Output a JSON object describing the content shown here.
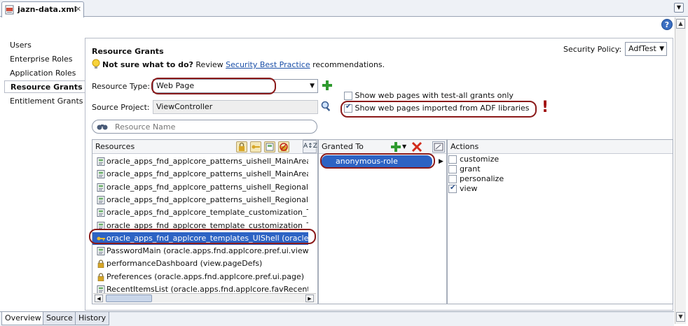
{
  "editor": {
    "tab_label": "jazn-data.xml",
    "close_glyph": "×",
    "menu_glyph": "▼",
    "help_glyph": "?"
  },
  "nav": {
    "items": [
      {
        "label": "Users"
      },
      {
        "label": "Enterprise Roles"
      },
      {
        "label": "Application Roles"
      },
      {
        "label": "Resource Grants",
        "selected": true
      },
      {
        "label": "Entitlement Grants"
      }
    ]
  },
  "header": {
    "title": "Resource Grants",
    "hint_bold": "Not sure what to do?",
    "hint_pre": "Review",
    "hint_link": "Security Best Practice",
    "hint_post": "recommendations.",
    "security_policy_label": "Security Policy:",
    "security_policy_value": "AdfTest"
  },
  "form": {
    "resource_type_label": "Resource Type:",
    "resource_type_value": "Web Page",
    "source_project_label": "Source Project:",
    "source_project_value": "ViewController",
    "check_test_all": {
      "label": "Show web pages with test-all grants only",
      "checked": false
    },
    "check_adf": {
      "label": "Show web pages imported from ADF libraries",
      "checked": true
    },
    "exclamation": "!",
    "search_placeholder": "Resource Name"
  },
  "resources_panel": {
    "header": "Resources",
    "rows": [
      {
        "text": "oracle_apps_fnd_applcore_patterns_uishell_MainArea",
        "icon": "page"
      },
      {
        "text": "oracle_apps_fnd_applcore_patterns_uishell_MainArea",
        "icon": "page"
      },
      {
        "text": "oracle_apps_fnd_applcore_patterns_uishell_Regional",
        "icon": "page"
      },
      {
        "text": "oracle_apps_fnd_applcore_patterns_uishell_Regional",
        "icon": "page"
      },
      {
        "text": "oracle_apps_fnd_applcore_template_customization_T",
        "icon": "page"
      },
      {
        "text": "oracle_apps_fnd_applcore_template_customization_T",
        "icon": "page"
      },
      {
        "text": "oracle_apps_fnd_applcore_templates_UIShell (oracle.",
        "icon": "key",
        "selected": true
      },
      {
        "text": "PasswordMain (oracle.apps.fnd.applcore.pref.ui.view)",
        "icon": "page"
      },
      {
        "text": "performanceDashboard (view.pageDefs)",
        "icon": "lock"
      },
      {
        "text": "Preferences (oracle.apps.fnd.applcore.pref.ui.page)",
        "icon": "lock"
      },
      {
        "text": "RecentItemsList (oracle.apps.fnd.applcore.favRecentIt",
        "icon": "page"
      }
    ]
  },
  "granted_panel": {
    "header": "Granted To",
    "rows": [
      {
        "text": "anonymous-role",
        "selected": true
      }
    ]
  },
  "actions_panel": {
    "header": "Actions",
    "rows": [
      {
        "text": "customize",
        "checked": false
      },
      {
        "text": "grant",
        "checked": false
      },
      {
        "text": "personalize",
        "checked": false
      },
      {
        "text": "view",
        "checked": true
      }
    ]
  },
  "bottom_tabs": [
    {
      "label": "Overview",
      "selected": true
    },
    {
      "label": "Source"
    },
    {
      "label": "History"
    }
  ],
  "colors": {
    "selection": "#2d63c4",
    "highlight_ring": "#8b1a1a",
    "link": "#1a4fa8"
  }
}
